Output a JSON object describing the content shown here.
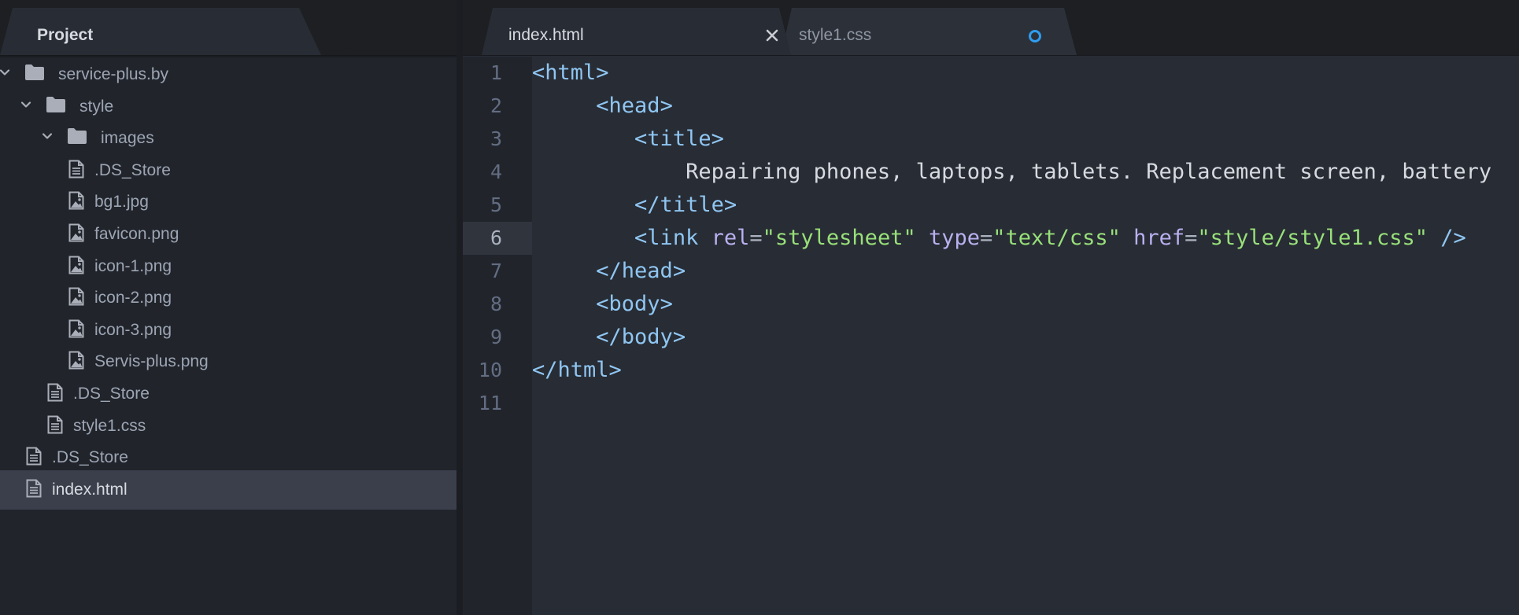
{
  "sidebar": {
    "panel_title": "Project",
    "tree": [
      {
        "label": "service-plus.by",
        "type": "folder",
        "depth": 0,
        "expanded": true,
        "icon": "folder-icon"
      },
      {
        "label": "style",
        "type": "folder",
        "depth": 1,
        "expanded": true,
        "icon": "folder-icon"
      },
      {
        "label": "images",
        "type": "folder",
        "depth": 2,
        "expanded": true,
        "icon": "folder-icon"
      },
      {
        "label": ".DS_Store",
        "type": "file",
        "depth": 3,
        "icon": "file-text-icon"
      },
      {
        "label": "bg1.jpg",
        "type": "image",
        "depth": 3,
        "icon": "file-image-icon"
      },
      {
        "label": "favicon.png",
        "type": "image",
        "depth": 3,
        "icon": "file-image-icon"
      },
      {
        "label": "icon-1.png",
        "type": "image",
        "depth": 3,
        "icon": "file-image-icon"
      },
      {
        "label": "icon-2.png",
        "type": "image",
        "depth": 3,
        "icon": "file-image-icon"
      },
      {
        "label": "icon-3.png",
        "type": "image",
        "depth": 3,
        "icon": "file-image-icon"
      },
      {
        "label": "Servis-plus.png",
        "type": "image",
        "depth": 3,
        "icon": "file-image-icon"
      },
      {
        "label": ".DS_Store",
        "type": "file",
        "depth": 2,
        "icon": "file-text-icon"
      },
      {
        "label": "style1.css",
        "type": "file",
        "depth": 2,
        "icon": "file-text-icon"
      },
      {
        "label": ".DS_Store",
        "type": "file",
        "depth": 1,
        "icon": "file-text-icon"
      },
      {
        "label": "index.html",
        "type": "file",
        "depth": 1,
        "icon": "file-text-icon",
        "selected": true
      }
    ]
  },
  "editor": {
    "tabs": [
      {
        "label": "index.html",
        "active": true,
        "close_icon": "close-icon"
      },
      {
        "label": "style1.css",
        "active": false,
        "modified": true,
        "modified_icon": "modified-dot-icon"
      }
    ],
    "current_line": 6,
    "line_numbers": [
      "1",
      "2",
      "3",
      "4",
      "5",
      "6",
      "7",
      "8",
      "9",
      "10",
      "11"
    ],
    "lines": [
      "<html>",
      "     <head>",
      "        <title>",
      "            Repairing phones, laptops, tablets. Replacement screen, battery",
      "        </title>",
      "        <link rel=\"stylesheet\" type=\"text/css\" href=\"style/style1.css\" />",
      "     </head>",
      "     <body>",
      "     </body>",
      "</html>",
      ""
    ]
  },
  "colors": {
    "background": "#282c34",
    "sidebar_bg": "#21252b",
    "tag": "#8fc6f2",
    "attribute": "#b9b0f0",
    "string": "#98e07a",
    "modified_dot": "#2f9df0"
  }
}
